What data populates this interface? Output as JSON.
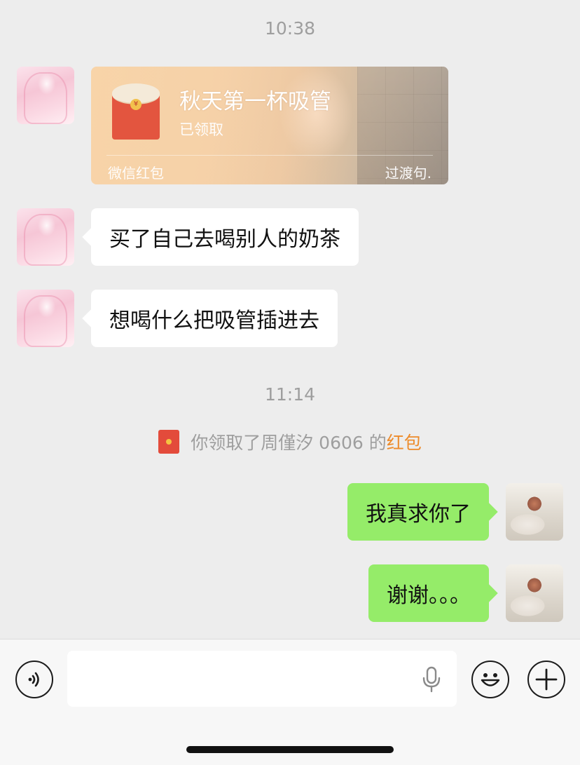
{
  "chat": {
    "timestamps": [
      "10:38",
      "11:14"
    ],
    "red_packet": {
      "title": "秋天第一杯吸管",
      "status": "已领取",
      "source": "微信红包",
      "tag": "过渡句.",
      "coin": "¥"
    },
    "incoming": [
      "买了自己去喝别人的奶茶",
      "想喝什么把吸管插进去"
    ],
    "system": {
      "prefix": "你领取了周僅汐 0606 的",
      "link": "红包"
    },
    "outgoing": [
      "我真求你了",
      "谢谢。。。"
    ]
  },
  "input_bar": {
    "value": "",
    "icons": [
      "voice-toggle-icon",
      "microphone-icon",
      "emoji-icon",
      "add-icon"
    ]
  },
  "colors": {
    "background": "#ededed",
    "incoming_bubble": "#ffffff",
    "outgoing_bubble": "#95ec69",
    "red_packet": "#e3553f",
    "link": "#ed8b2b"
  }
}
